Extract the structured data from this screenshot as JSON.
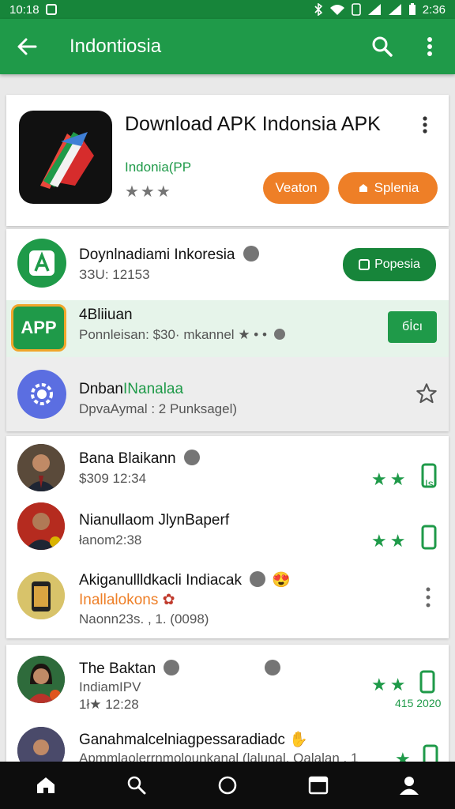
{
  "status_bar": {
    "time": "10:18",
    "battery_time": "2:36"
  },
  "app_bar": {
    "title": "Indontiosia"
  },
  "featured": {
    "title": "Download APK Indonsia APK",
    "developer": "Indonia(PP",
    "stars": "★★★",
    "button1": "Veaton",
    "button2": "Splenia"
  },
  "list1": [
    {
      "title": "Doynlnadiami Inkoresia",
      "subtitle": "ЗЗU: 12153",
      "button": "Popesia"
    },
    {
      "icon_text": "APP",
      "title": "4Bliiuan",
      "subtitle": "Ponnleisan: $30· mkannel",
      "button": "бİcı"
    },
    {
      "title_black": "Dnban",
      "title_green": "INanalaa",
      "subtitle": "DpvaAymal : 2 Punksagel)"
    }
  ],
  "list2": [
    {
      "title": "Bana Blaikann",
      "subtitle": "$309 12:34",
      "side_label": "IIs"
    },
    {
      "title": "Nianullaom JlynBaperf",
      "subtitle": "łanom2:38"
    },
    {
      "title": "Akiganullldkacli Indiacak",
      "subtitle_orange": "Inallalokons",
      "subtitle": "Naonn23s. , 1. (0098)"
    }
  ],
  "list3": [
    {
      "title": "The Baktan",
      "subtitle": "IndiamIPV",
      "subtitle2": "1ł★ 12:28",
      "side_label": "415 2020"
    },
    {
      "title": "Ganahmalcelniagpessaradiadc",
      "subtitle": "Apmmlaolerrnmolounkanal (lalunal, Qalalan , 1"
    }
  ],
  "colors": {
    "primary": "#1f9a49",
    "primary_dark": "#17853a",
    "accent": "#ee7f27"
  },
  "icons": [
    "back-arrow-icon",
    "search-icon",
    "more-vert-icon",
    "star-outline-icon",
    "home-icon",
    "phone-icon"
  ]
}
